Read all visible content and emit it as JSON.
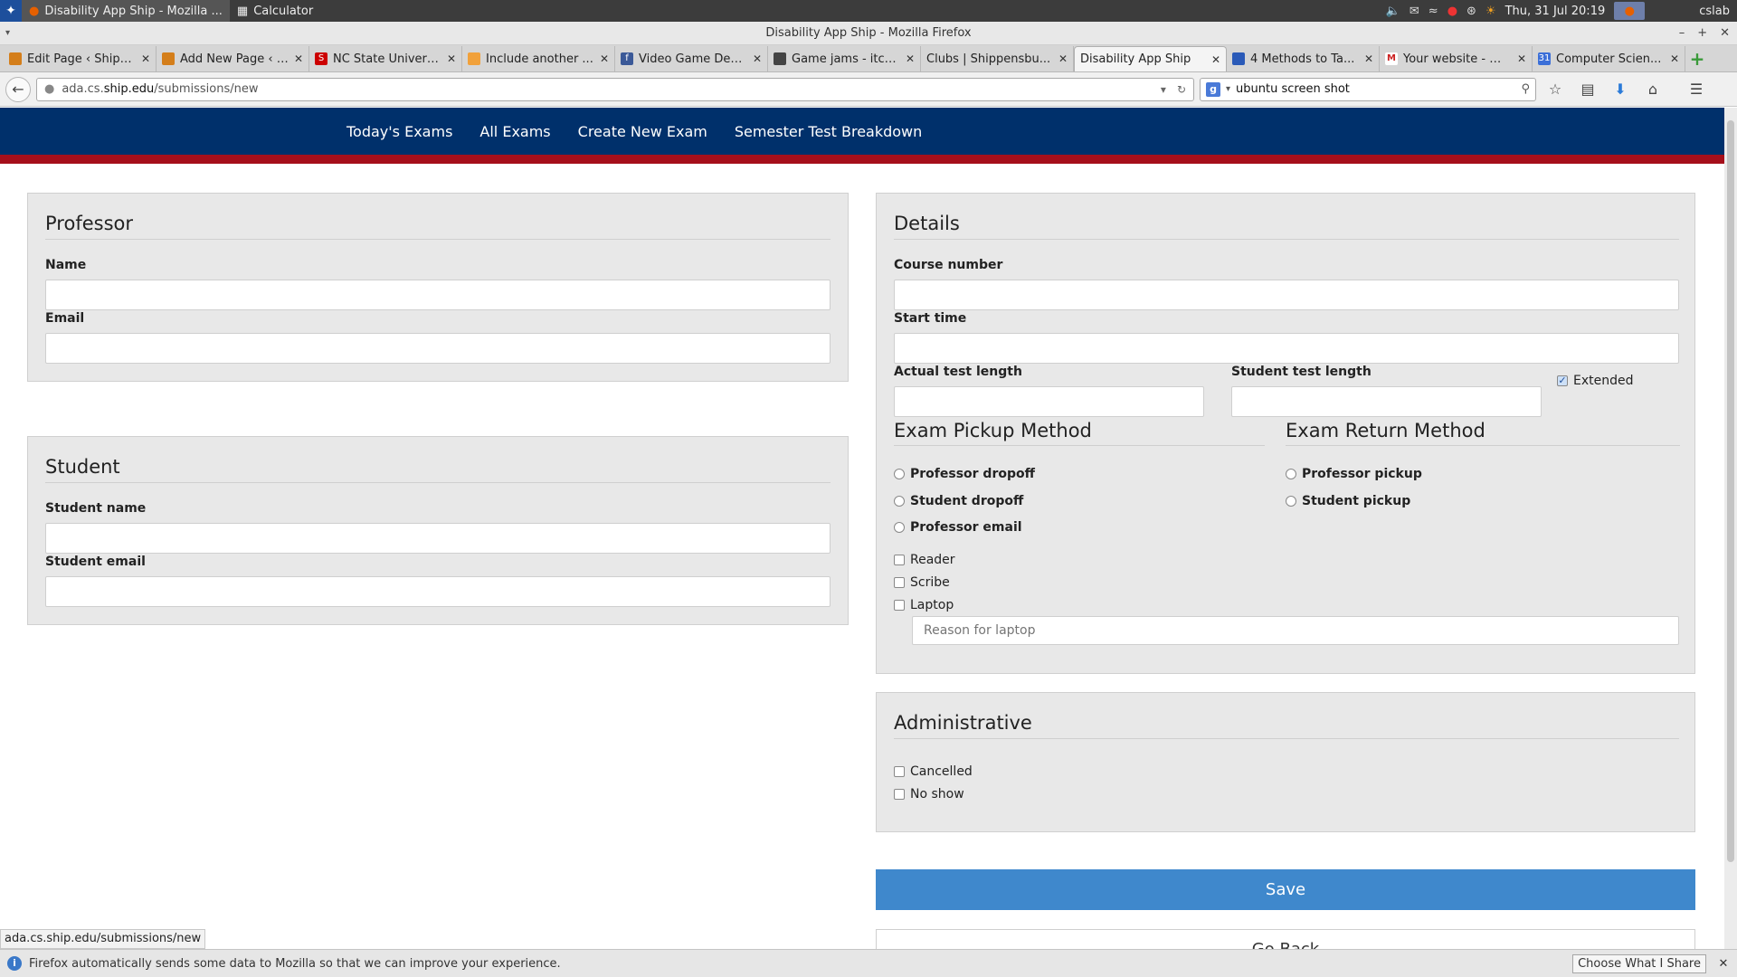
{
  "system": {
    "tasks": [
      {
        "label": "Disability App Ship - Mozilla ..."
      },
      {
        "label": "Calculator"
      }
    ],
    "datetime": "Thu, 31 Jul  20:19",
    "user": "cslab"
  },
  "window": {
    "title": "Disability App Ship - Mozilla Firefox"
  },
  "tabs": [
    {
      "label": "Edit Page ‹ Shippens...",
      "fav_color": "#d47e1a"
    },
    {
      "label": "Add New Page ‹ Shi...",
      "fav_color": "#d47e1a"
    },
    {
      "label": "NC State Univers...",
      "fav_color": "#cc0000"
    },
    {
      "label": "Include another ...",
      "fav_color": "#f1a13b"
    },
    {
      "label": "Video Game Dev...",
      "fav_color": "#3b5998"
    },
    {
      "label": "Game jams - itch...",
      "fav_color": "#444444"
    },
    {
      "label": "Clubs | Shippensbu...",
      "fav_color": "#d6d6d6"
    },
    {
      "label": "Disability App Ship",
      "fav_color": "#f4f4f4"
    },
    {
      "label": "4 Methods to Ta...",
      "fav_color": "#2a5ab8"
    },
    {
      "label": "Your website - m...",
      "fav_color": "#cc2222"
    },
    {
      "label": "Computer Scien...",
      "fav_color": "#3b6fd8"
    }
  ],
  "url": {
    "prefix": "ada.cs.",
    "host": "ship.edu",
    "path": "/submissions/new"
  },
  "search": {
    "value": "ubuntu screen shot"
  },
  "nav": {
    "items": [
      "Today's Exams",
      "All Exams",
      "Create New Exam",
      "Semester Test Breakdown"
    ]
  },
  "professor": {
    "heading": "Professor",
    "name_label": "Name",
    "email_label": "Email"
  },
  "student": {
    "heading": "Student",
    "name_label": "Student name",
    "email_label": "Student email"
  },
  "details": {
    "heading": "Details",
    "course_label": "Course number",
    "start_label": "Start time",
    "actual_label": "Actual test length",
    "student_len_label": "Student test length",
    "extended_label": "Extended",
    "extended_checked": true,
    "pickup_heading": "Exam Pickup Method",
    "pickup_options": [
      "Professor dropoff",
      "Student dropoff",
      "Professor email"
    ],
    "return_heading": "Exam Return Method",
    "return_options": [
      "Professor pickup",
      "Student pickup"
    ],
    "reader_label": "Reader",
    "scribe_label": "Scribe",
    "laptop_label": "Laptop",
    "laptop_reason_placeholder": "Reason for laptop"
  },
  "admin": {
    "heading": "Administrative",
    "cancelled_label": "Cancelled",
    "noshow_label": "No show"
  },
  "buttons": {
    "save": "Save",
    "back": "Go Back"
  },
  "status": {
    "hover_url": "ada.cs.ship.edu/submissions/new",
    "notification": "Firefox automatically sends some data to Mozilla so that we can improve your experience.",
    "choose_label": "Choose What I Share"
  }
}
